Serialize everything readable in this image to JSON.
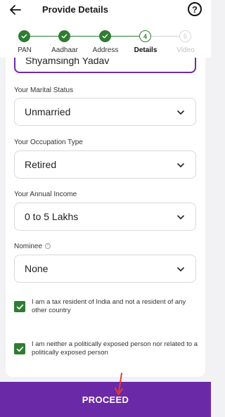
{
  "header": {
    "title": "Provide Details",
    "back_icon": "arrow-left-icon",
    "help_icon": "?"
  },
  "stepper": {
    "steps": [
      {
        "label": "PAN",
        "state": "done",
        "number": ""
      },
      {
        "label": "Aadhaar",
        "state": "done",
        "number": ""
      },
      {
        "label": "Address",
        "state": "done",
        "number": ""
      },
      {
        "label": "Details",
        "state": "current",
        "number": "4"
      },
      {
        "label": "Video",
        "state": "todo",
        "number": "5"
      }
    ]
  },
  "form": {
    "name_value": "Shyamsingh Yadav",
    "marital": {
      "label": "Your Marital Status",
      "value": "Unmarried"
    },
    "occupation": {
      "label": "Your Occupation Type",
      "value": "Retired"
    },
    "income": {
      "label": "Your Annual Income",
      "value": "0 to 5 Lakhs"
    },
    "nominee": {
      "label": "Nominee",
      "value": "None"
    },
    "declarations": [
      {
        "text": "I am a tax resident of India and not a resident of any other country",
        "checked": true
      },
      {
        "text": "I am neither a politically exposed person nor related to a politically exposed person",
        "checked": true
      }
    ]
  },
  "proceed_label": "PROCEED",
  "colors": {
    "primary": "#6a2aa8",
    "success": "#2e7d32",
    "annotation": "#e53935"
  }
}
